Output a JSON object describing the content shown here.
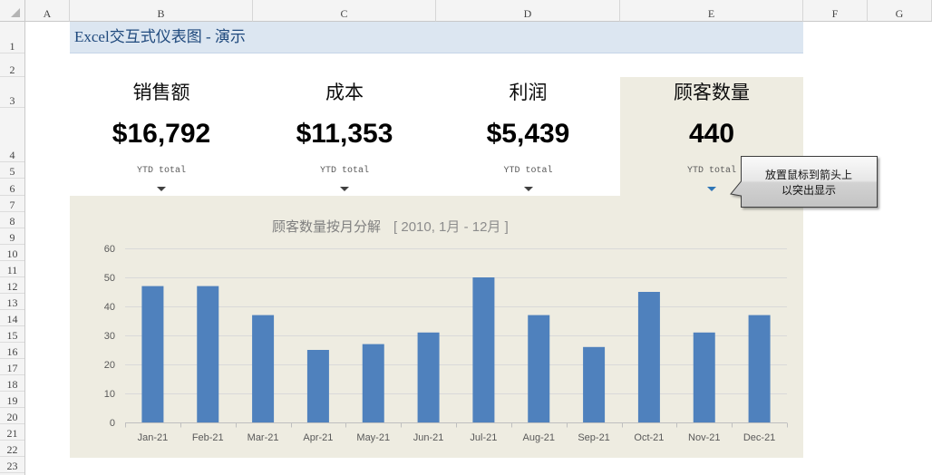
{
  "sheet": {
    "columns": [
      "A",
      "B",
      "C",
      "D",
      "E",
      "F",
      "G"
    ],
    "rows": [
      "1",
      "2",
      "3",
      "4",
      "5",
      "6",
      "7",
      "8",
      "9",
      "10",
      "11",
      "12",
      "13",
      "14",
      "15",
      "16",
      "17",
      "18",
      "19",
      "20",
      "21",
      "22",
      "23"
    ]
  },
  "title": {
    "text": "Excel交互式仪表图 - 演示"
  },
  "kpis": [
    {
      "label": "销售额",
      "value": "$16,792",
      "note": "YTD total",
      "icon": "arrow-down-icon",
      "active": false
    },
    {
      "label": "成本",
      "value": "$11,353",
      "note": "YTD total",
      "icon": "arrow-down-icon",
      "active": false
    },
    {
      "label": "利润",
      "value": "$5,439",
      "note": "YTD total",
      "icon": "arrow-down-icon",
      "active": false
    },
    {
      "label": "顾客数量",
      "value": "440",
      "note": "YTD total",
      "icon": "arrow-down-icon",
      "active": true
    }
  ],
  "tooltip": {
    "line1": "放置鼠标到箭头上",
    "line2": "以突出显示"
  },
  "colors": {
    "panel": "#eeece1",
    "title_band": "#dce6f1",
    "title_text": "#1f497d",
    "arrow": "#404040",
    "arrow_active": "#2e75b6",
    "bar": "#4f81bd"
  },
  "chart_data": {
    "type": "bar",
    "title": "顾客数量按月分解",
    "subtitle": "[ 2010, 1月 - 12月 ]",
    "categories": [
      "Jan-21",
      "Feb-21",
      "Mar-21",
      "Apr-21",
      "May-21",
      "Jun-21",
      "Jul-21",
      "Aug-21",
      "Sep-21",
      "Oct-21",
      "Nov-21",
      "Dec-21"
    ],
    "values": [
      47,
      47,
      37,
      25,
      27,
      31,
      50,
      37,
      26,
      45,
      31,
      37
    ],
    "ylim": [
      0,
      60
    ],
    "yticks": [
      0,
      10,
      20,
      30,
      40,
      50,
      60
    ],
    "grid": true,
    "legend": "none",
    "bar_color": "#4f81bd"
  }
}
